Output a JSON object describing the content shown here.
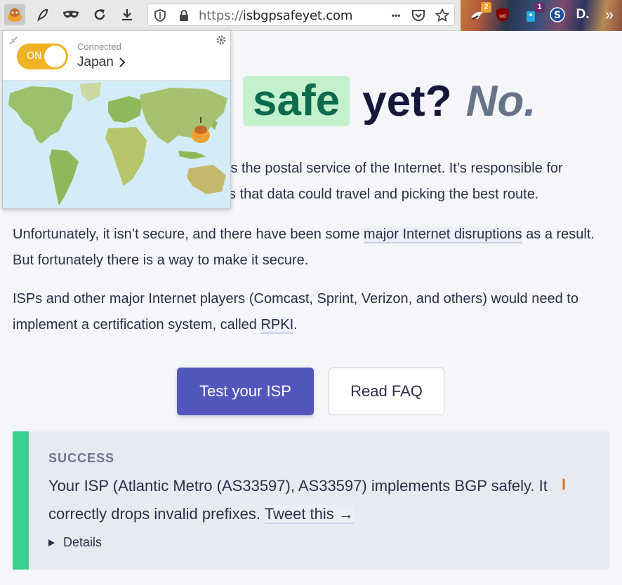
{
  "browser": {
    "url_scheme": "https://",
    "url_host": "isbgpsafeyet.com",
    "more_label": "•••",
    "extensions": [
      {
        "name": "bird-icon",
        "badge": "2",
        "badge_color": "#f0a030"
      },
      {
        "name": "ublock-icon",
        "badge": "",
        "badge_color": ""
      },
      {
        "name": "tag-icon",
        "badge": "1",
        "badge_color": "#6a2b66"
      },
      {
        "name": "s-icon",
        "badge": "",
        "badge_color": ""
      },
      {
        "name": "d-icon",
        "badge": "",
        "badge_color": ""
      }
    ],
    "ext_d_label": "D.",
    "ext_s_label": "S",
    "overflow_label": "»"
  },
  "vpn": {
    "toggle_label": "ON",
    "status": "Connected",
    "location": "Japan",
    "toggle_color": "#f0b324"
  },
  "page": {
    "heading_safe": "safe",
    "heading_yet": "yet?",
    "heading_no": "No.",
    "p1_line1": "is the postal service of the Internet. It’s responsible for",
    "p1_line2": "s that data could travel and picking the best route.",
    "p2_a": "Unfortunately, it isn’t secure, and there have been some ",
    "p2_link": "major Internet disruptions",
    "p2_b": " as a result. But fortunately there is a way to make it secure.",
    "p3_a": "ISPs and other major Internet players (Comcast, Sprint, Verizon, and others) would need to implement a certification system, called ",
    "p3_link": "RPKI",
    "p3_b": ".",
    "btn_test": "Test your ISP",
    "btn_faq": "Read FAQ",
    "result_label": "SUCCESS",
    "result_text": "Your ISP (Atlantic Metro (AS33597), AS33597) implements BGP safely. It correctly drops invalid prefixes. ",
    "result_link": "Tweet this →",
    "details": "Details"
  }
}
